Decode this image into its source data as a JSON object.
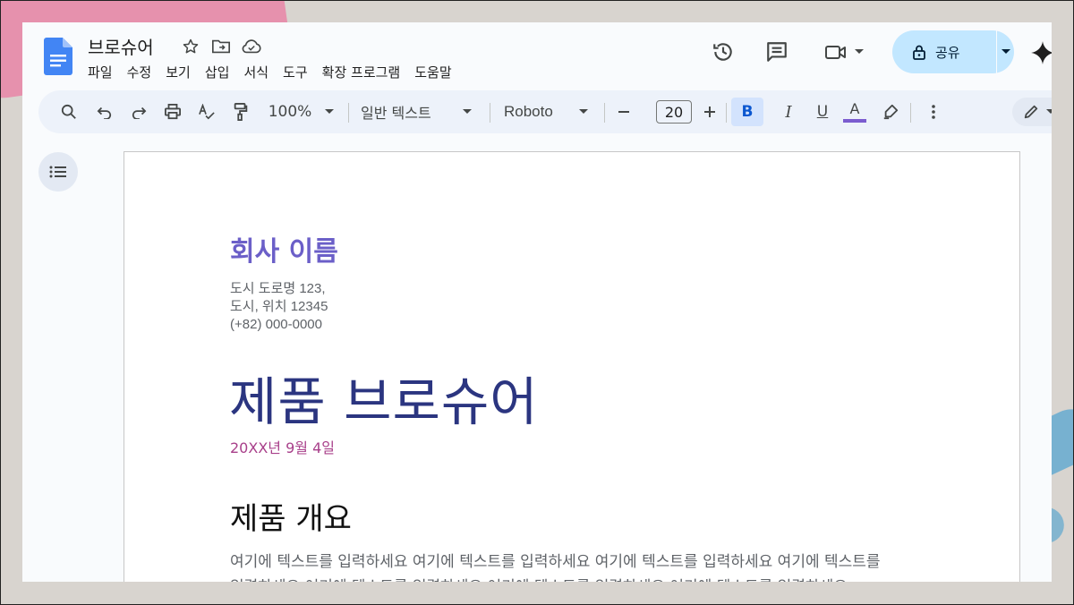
{
  "doc": {
    "title": "브로슈어",
    "menu": [
      "파일",
      "수정",
      "보기",
      "삽입",
      "서식",
      "도구",
      "확장 프로그램",
      "도움말"
    ],
    "share_label": "공유"
  },
  "toolbar": {
    "zoom": "100%",
    "style": "일반 텍스트",
    "font": "Roboto",
    "font_size": "20",
    "bold_label": "B",
    "italic_label": "I",
    "underline_label": "U",
    "text_color_label": "A",
    "text_color": "#7b5ccf"
  },
  "page": {
    "company_name": "회사 이름",
    "address_line1": "도시 도로명 123,",
    "address_line2": "도시, 위치 12345",
    "phone": "(+82) 000-0000",
    "product_title": "제품 브로슈어",
    "date": "20XX년 9월 4일",
    "section_heading": "제품 개요",
    "body_line1": "여기에 텍스트를 입력하세요 여기에 텍스트를 입력하세요 여기에 텍스트를 입력하세요 여기에 텍스트를",
    "body_line2": "입력하세요 여기에 텍스트를 입력하세요 여기에 텍스트를 입력하세요 여기에 텍스트를 입력하세요"
  },
  "colors": {
    "accent": "#0b57d0",
    "share_bg": "#c2e7ff",
    "company": "#6b5fc8",
    "title": "#2b3580",
    "date": "#a83f8a"
  }
}
